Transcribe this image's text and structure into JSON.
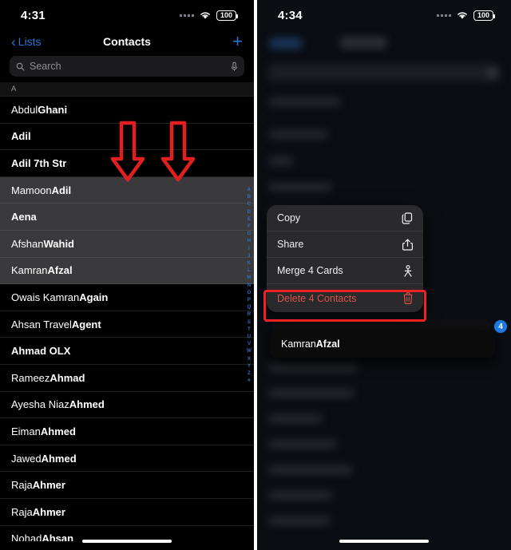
{
  "left_phone": {
    "status_bar": {
      "time": "4:31",
      "wifi_icon": "wifi-icon",
      "battery": "100"
    },
    "nav": {
      "back_label": "Lists",
      "title": "Contacts",
      "add_label": "+"
    },
    "search": {
      "placeholder": "Search",
      "search_icon": "search-icon",
      "mic_icon": "microphone-icon"
    },
    "section_header": "A",
    "alpha_index": [
      "A",
      "B",
      "C",
      "D",
      "E",
      "F",
      "G",
      "H",
      "I",
      "J",
      "K",
      "L",
      "M",
      "N",
      "O",
      "P",
      "Q",
      "R",
      "S",
      "T",
      "U",
      "V",
      "W",
      "X",
      "Y",
      "Z",
      "#"
    ],
    "contacts": [
      {
        "first": "Abdul ",
        "last": "Ghani",
        "selected": false
      },
      {
        "first": "",
        "last": "Adil",
        "selected": false
      },
      {
        "first": "",
        "last": "Adil 7th Str",
        "selected": false
      },
      {
        "first": "Mamoon ",
        "last": "Adil",
        "selected": true
      },
      {
        "first": "",
        "last": "Aena",
        "selected": true
      },
      {
        "first": "Afshan ",
        "last": "Wahid",
        "selected": true
      },
      {
        "first": "Kamran ",
        "last": "Afzal",
        "selected": true
      },
      {
        "first": "Owais Kamran ",
        "last": "Again",
        "selected": false
      },
      {
        "first": "Ahsan Travel ",
        "last": "Agent",
        "selected": false
      },
      {
        "first": "",
        "last": "Ahmad OLX",
        "selected": false
      },
      {
        "first": "Rameez ",
        "last": "Ahmad",
        "selected": false
      },
      {
        "first": "Ayesha Niaz ",
        "last": "Ahmed",
        "selected": false
      },
      {
        "first": "Eiman ",
        "last": "Ahmed",
        "selected": false
      },
      {
        "first": "Jawed ",
        "last": "Ahmed",
        "selected": false
      },
      {
        "first": "Raja ",
        "last": "Ahmer",
        "selected": false
      },
      {
        "first": "Raja ",
        "last": "Ahmer",
        "selected": false
      },
      {
        "first": "Nohad ",
        "last": "Ahsan",
        "selected": false
      }
    ],
    "annotation": {
      "arrow_color": "#e02020",
      "arrow_count": 2,
      "arrow_icon": "down-arrow-annotation"
    }
  },
  "right_phone": {
    "status_bar": {
      "time": "4:34",
      "wifi_icon": "wifi-icon",
      "battery": "100"
    },
    "context_menu": [
      {
        "label": "Copy",
        "icon": "copy-icon",
        "destructive": false
      },
      {
        "label": "Share",
        "icon": "share-icon",
        "destructive": false
      },
      {
        "label": "Merge 4 Cards",
        "icon": "merge-person-icon",
        "destructive": false
      },
      {
        "label": "Delete 4 Contacts",
        "icon": "trash-icon",
        "destructive": true
      }
    ],
    "highlight_color": "#ee2222",
    "drag_card": {
      "first": "Kamran ",
      "last": "Afzal"
    },
    "badge_count": "4"
  }
}
